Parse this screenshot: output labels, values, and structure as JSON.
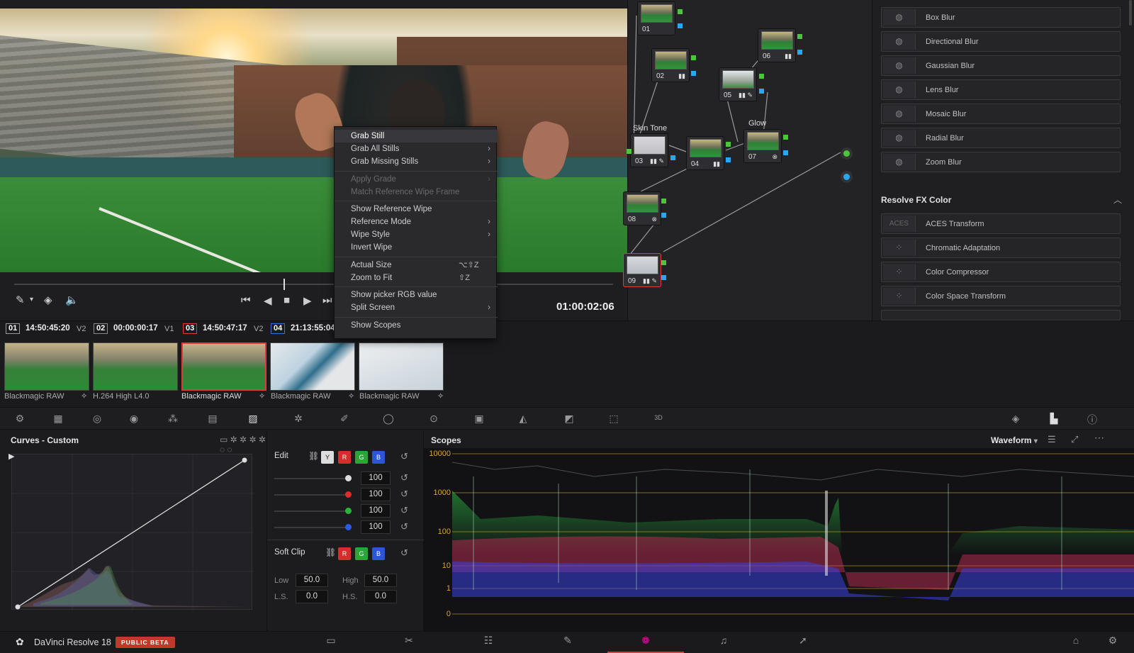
{
  "viewer": {
    "timecode": "01:00:02:06"
  },
  "menu": {
    "items": [
      {
        "label": "Grab Still",
        "arrow": "",
        "shortcut": "",
        "disabled": false,
        "highlight": true
      },
      {
        "label": "Grab All Stills",
        "arrow": "›",
        "shortcut": "",
        "disabled": false
      },
      {
        "label": "Grab Missing Stills",
        "arrow": "›",
        "shortcut": "",
        "disabled": false
      },
      {
        "label": "Apply Grade",
        "arrow": "›",
        "shortcut": "",
        "disabled": true
      },
      {
        "label": "Match Reference Wipe Frame",
        "arrow": "",
        "shortcut": "",
        "disabled": true
      },
      {
        "label": "Show Reference Wipe",
        "arrow": "",
        "shortcut": "",
        "disabled": false
      },
      {
        "label": "Reference Mode",
        "arrow": "›",
        "shortcut": "",
        "disabled": false
      },
      {
        "label": "Wipe Style",
        "arrow": "›",
        "shortcut": "",
        "disabled": false
      },
      {
        "label": "Invert Wipe",
        "arrow": "",
        "shortcut": "",
        "disabled": false
      },
      {
        "label": "Actual Size",
        "arrow": "",
        "shortcut": "⌥⇧Z",
        "disabled": false
      },
      {
        "label": "Zoom to Fit",
        "arrow": "",
        "shortcut": "⇧Z",
        "disabled": false
      },
      {
        "label": "Show picker RGB value",
        "arrow": "",
        "shortcut": "",
        "disabled": false
      },
      {
        "label": "Split Screen",
        "arrow": "›",
        "shortcut": "",
        "disabled": false
      },
      {
        "label": "Show Scopes",
        "arrow": "",
        "shortcut": "",
        "disabled": false
      }
    ]
  },
  "nodes": {
    "labels": [
      "01",
      "02",
      "03",
      "04",
      "05",
      "06",
      "07",
      "08",
      "09"
    ],
    "skin_tone": "Skin Tone",
    "glow": "Glow"
  },
  "fx": {
    "blur": [
      "Box Blur",
      "Directional Blur",
      "Gaussian Blur",
      "Lens Blur",
      "Mosaic Blur",
      "Radial Blur",
      "Zoom Blur"
    ],
    "section": "Resolve FX Color",
    "color": [
      "ACES Transform",
      "Chromatic Adaptation",
      "Color Compressor",
      "Color Space Transform"
    ],
    "aces_icon": "ACES"
  },
  "clips": [
    {
      "num": "01",
      "tc": "14:50:45:20",
      "track": "V2",
      "codec": "Blackmagic RAW"
    },
    {
      "num": "02",
      "tc": "00:00:00:17",
      "track": "V1",
      "codec": "H.264 High L4.0"
    },
    {
      "num": "03",
      "tc": "14:50:47:17",
      "track": "V2",
      "codec": "Blackmagic RAW"
    },
    {
      "num": "04",
      "tc": "21:13:55:04",
      "track": "",
      "codec": "Blackmagic RAW"
    },
    {
      "num": "",
      "tc": "",
      "track": "",
      "codec": "Blackmagic RAW"
    }
  ],
  "curves": {
    "title": "Curves - Custom"
  },
  "edit": {
    "title": "Edit",
    "channels": [
      "Y",
      "R",
      "G",
      "B"
    ],
    "values": [
      "100",
      "100",
      "100",
      "100"
    ],
    "softclip": "Soft Clip",
    "low_label": "Low",
    "low": "50.0",
    "high_label": "High",
    "high": "50.0",
    "ls_label": "L.S.",
    "ls": "0.0",
    "hs_label": "H.S.",
    "hs": "0.0"
  },
  "scopes": {
    "title": "Scopes",
    "mode": "Waveform",
    "scale": [
      "10000",
      "1000",
      "100",
      "10",
      "1",
      "0"
    ]
  },
  "footer": {
    "app": "DaVinci Resolve 18",
    "badge": "PUBLIC BETA"
  },
  "colors": {
    "accent_red": "#e23a3a",
    "pin_green": "#4bc63a",
    "pin_blue": "#2aa7f2",
    "scale_amber": "#d9a43a"
  }
}
